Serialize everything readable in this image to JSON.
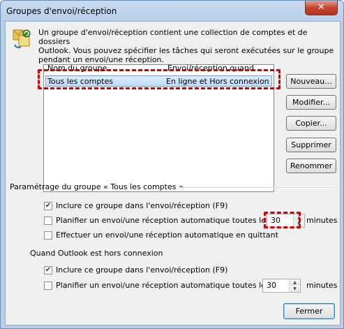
{
  "window": {
    "title": "Groupes d'envoi/réception",
    "close_glyph": "✕"
  },
  "intro": {
    "line1": "Un groupe d'envoi/réception contient une collection de comptes et de dossiers",
    "line2": "Outlook. Vous pouvez spécifier les tâches qui seront exécutées sur le groupe",
    "line3": "pendant un envoi/une réception.",
    "icon": "send-receive-groups-icon"
  },
  "group_list": {
    "col_name": "Nom du groupe",
    "col_when": "Envoi/réception quand",
    "rows": [
      {
        "name": "Tous les comptes",
        "when": "En ligne et Hors connexion"
      }
    ]
  },
  "buttons": {
    "new": "Nouveau...",
    "modify": "Modifier...",
    "copy": "Copier...",
    "delete": "Supprimer",
    "rename": "Renommer",
    "close": "Fermer"
  },
  "settings": {
    "header": "Paramétrage du groupe « Tous les comptes »",
    "online": {
      "include": {
        "label": "Inclure ce groupe dans l'envoi/réception (F9)",
        "checked": true
      },
      "schedule": {
        "label": "Planifier un envoi/une réception automatique toutes les",
        "checked": false,
        "value": "30",
        "unit": "minutes"
      },
      "on_exit": {
        "label": "Effectuer un envoi/une réception automatique en quittant",
        "checked": false
      }
    },
    "offline_header": "Quand Outlook est hors connexion",
    "offline": {
      "include": {
        "label": "Inclure ce groupe dans l'envoi/réception (F9)",
        "checked": true
      },
      "schedule": {
        "label": "Planifier un envoi/une réception automatique toutes les",
        "checked": false,
        "value": "30",
        "unit": "minutes"
      }
    }
  },
  "glyphs": {
    "check": "✔",
    "up": "▲",
    "down": "▼"
  },
  "colors": {
    "highlight": "#d40000",
    "selection": "#c1dbfc"
  }
}
